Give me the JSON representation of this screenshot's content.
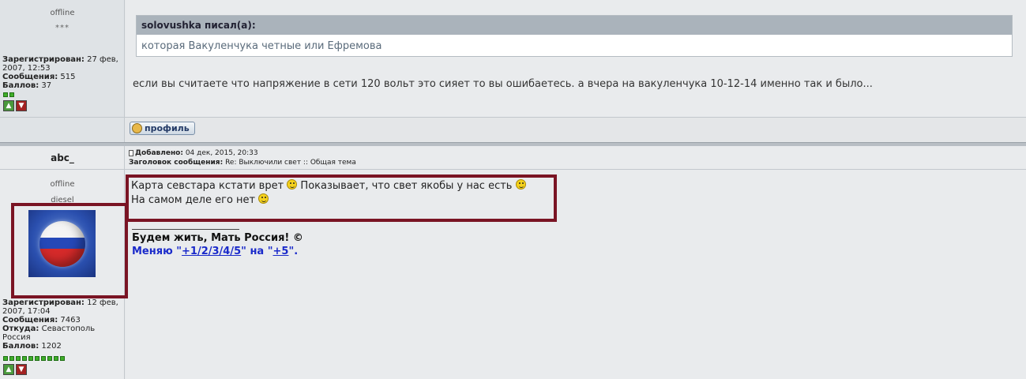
{
  "top_post": {
    "status": "offline",
    "stars": "***",
    "registered_label": "Зарегистрирован:",
    "registered_value": "27 фев, 2007, 12:53",
    "messages_label": "Сообщения:",
    "messages_value": "515",
    "points_label": "Баллов:",
    "points_value": "37",
    "rank_dots": 2,
    "quote_author": "solovushka писал(а):",
    "quote_text": "которая Вакуленчука четные или Ефремова",
    "post_text": "если вы считаете что напряжение в сети 120 вольт это сияет то вы ошибаетесь. а вчера на вакуленчука 10-12-14 именно так и было...",
    "profile_label": "профиль"
  },
  "second_post": {
    "author": "abc_",
    "added_label": "Добавлено:",
    "added_value": "04 дек, 2015, 20:33",
    "subject_label": "Заголовок сообщения:",
    "subject_value": "Re: Выключили свет :: Общая тема",
    "status": "offline",
    "user_title": "diesel",
    "registered_label": "Зарегистрирован:",
    "registered_value": "12 фев, 2007, 17:04",
    "messages_label": "Сообщения:",
    "messages_value": "7463",
    "from_label": "Откуда:",
    "from_value": "Севастополь Россия",
    "points_label": "Баллов:",
    "points_value": "1202",
    "rank_dots": 10,
    "message_part1": "Карта севстара кстати врет",
    "message_part2": "Показывает, что свет якобы у нас есть",
    "message_line2": "На самом деле его нет",
    "signature_line1": "Будем жить, Мать Россия! ©",
    "signature_prefix": "Меняю \"",
    "signature_link1": "+1/2/3/4/5",
    "signature_mid": "\" на \"",
    "signature_link2": "+5",
    "signature_suffix": "\"."
  },
  "colors": {
    "highlight_frame": "#7a1424",
    "quote_header": "#aab3bb",
    "signature_blue": "#1a2aca"
  }
}
